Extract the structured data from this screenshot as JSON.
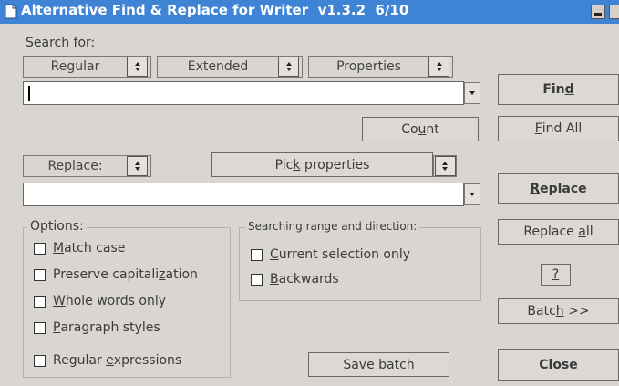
{
  "window": {
    "title": "Alternative Find & Replace for Writer  v1.3.2  6/10"
  },
  "search": {
    "label": "Search for:",
    "combo_regular": "Regular",
    "combo_extended": "Extended",
    "combo_properties": "Properties",
    "value": "",
    "count_pre": "Co",
    "count_key": "u",
    "count_post": "nt"
  },
  "replace": {
    "combo_replace": "Replace:",
    "pick_pre": "Pic",
    "pick_key": "k",
    "pick_post": " properties",
    "value": ""
  },
  "options": {
    "legend": "Options:",
    "items": [
      {
        "pre": "",
        "key": "M",
        "post": "atch case",
        "checked": false
      },
      {
        "pre": "Preserve capitali",
        "key": "z",
        "post": "ation",
        "checked": false
      },
      {
        "pre": "",
        "key": "W",
        "post": "hole words only",
        "checked": false
      },
      {
        "pre": "",
        "key": "P",
        "post": "aragraph styles",
        "checked": false
      },
      {
        "pre": "Regular ",
        "key": "e",
        "post": "xpressions",
        "checked": false
      }
    ]
  },
  "range": {
    "legend": "Searching range and direction:",
    "items": [
      {
        "pre": "",
        "key": "C",
        "post": "urrent selection only",
        "checked": false
      },
      {
        "pre": "",
        "key": "B",
        "post": "ackwards",
        "checked": false
      }
    ]
  },
  "buttons": {
    "find": {
      "pre": "Fin",
      "key": "d",
      "post": ""
    },
    "find_all": {
      "pre": "",
      "key": "F",
      "post": "ind All"
    },
    "replace": {
      "pre": "",
      "key": "R",
      "post": "eplace"
    },
    "replace_all": {
      "pre": "Replace ",
      "key": "a",
      "post": "ll"
    },
    "help": "?",
    "batch": {
      "pre": "Batc",
      "key": "h",
      "post": " >>"
    },
    "close": {
      "pre": "Cl",
      "key": "o",
      "post": "se"
    },
    "save_batch": {
      "pre": "",
      "key": "S",
      "post": "ave batch"
    }
  },
  "icons": [
    "document-icon",
    "minimize-icon",
    "maximize-icon",
    "spin-arrows-icon",
    "dropdown-arrow-icon"
  ]
}
